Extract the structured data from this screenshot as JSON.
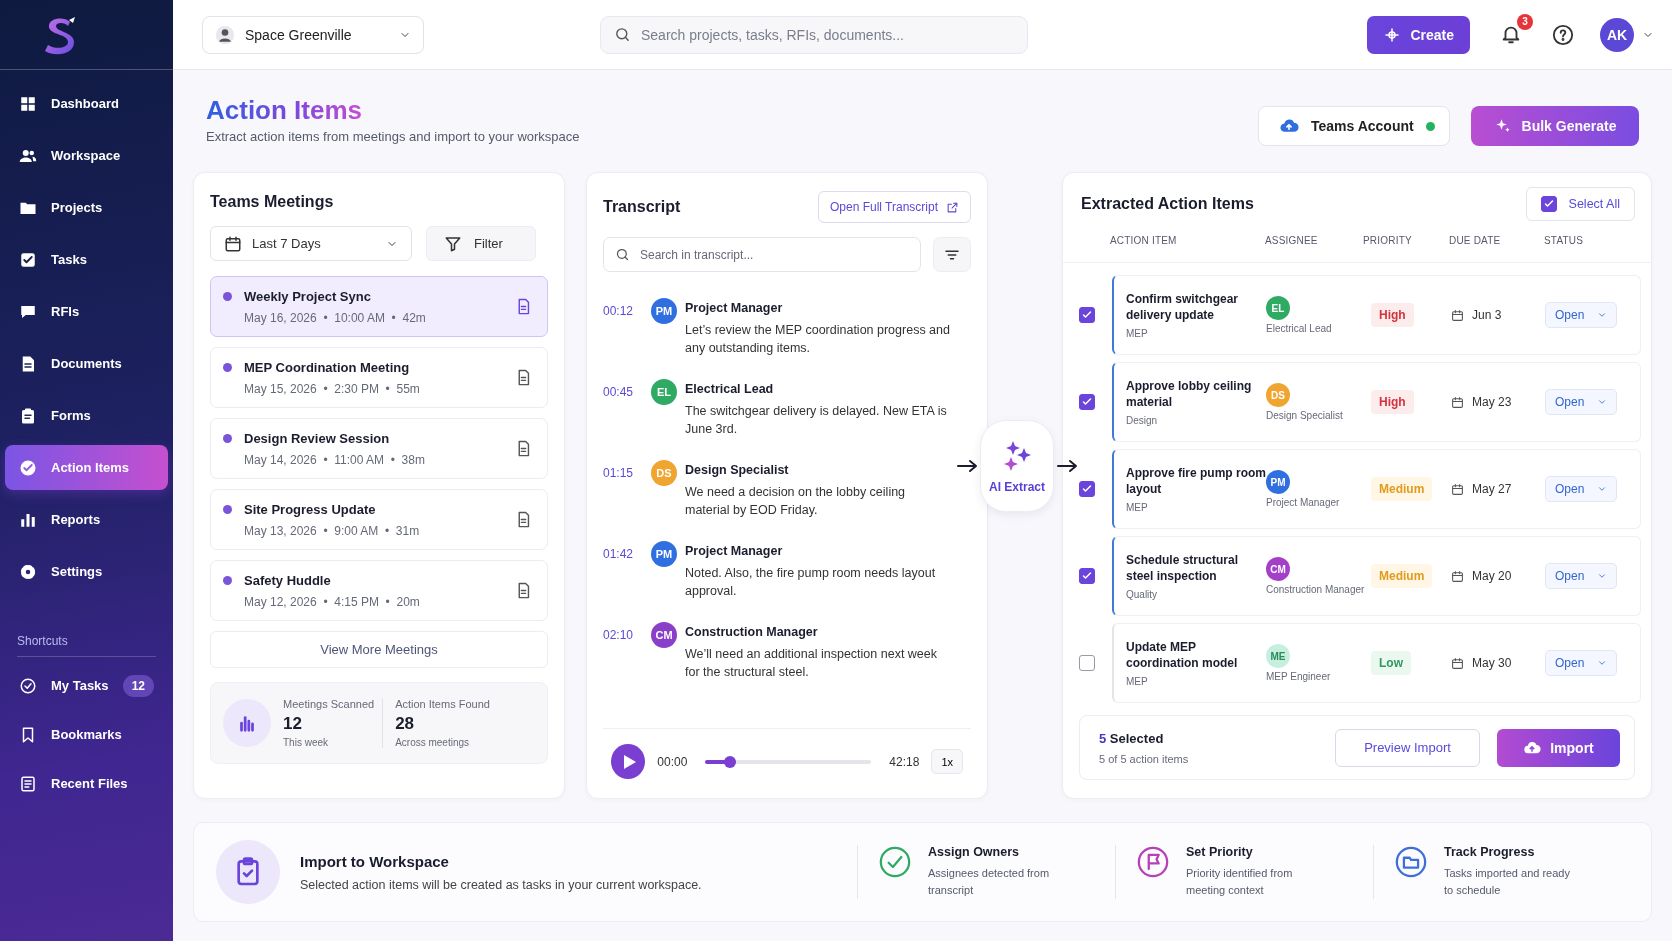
{
  "sidebar": {
    "items": [
      {
        "label": "Dashboard",
        "selected": false
      },
      {
        "label": "Workspace",
        "selected": false
      },
      {
        "label": "Projects",
        "selected": false
      },
      {
        "label": "Tasks",
        "selected": false
      },
      {
        "label": "RFIs",
        "selected": false
      },
      {
        "label": "Documents",
        "selected": false
      },
      {
        "label": "Forms",
        "selected": false
      },
      {
        "label": "Action Items",
        "selected": true
      },
      {
        "label": "Reports",
        "selected": false
      },
      {
        "label": "Settings",
        "selected": false
      }
    ],
    "shortcuts_title": "Shortcuts",
    "shortcuts": [
      {
        "label": "My Tasks",
        "badge": "12"
      },
      {
        "label": "Bookmarks"
      },
      {
        "label": "Recent Files"
      }
    ]
  },
  "topbar": {
    "workspace": "Space Greenville",
    "search": {
      "placeholder": "Search projects, tasks, RFIs, documents..."
    },
    "create": "Create",
    "notifications": "3",
    "avatar": "AK"
  },
  "header": {
    "title": "Action Items",
    "subtitle": "Extract action items from meetings and import to your workspace",
    "teams_account": {
      "label": "Teams Account",
      "connected": true
    },
    "bulk_generate": "Bulk Generate"
  },
  "meetings": {
    "title": "Teams Meetings",
    "range": "Last 7 Days",
    "filter": "Filter",
    "items": [
      {
        "title": "Weekly Project Sync",
        "meta": "May 16, 2026  •  10:00 AM  •  42m",
        "selected": true
      },
      {
        "title": "MEP Coordination Meeting",
        "meta": "May 15, 2026  •  2:30 PM  •  55m",
        "selected": false
      },
      {
        "title": "Design Review Session",
        "meta": "May 14, 2026  •  11:00 AM  •  38m",
        "selected": false
      },
      {
        "title": "Site Progress Update",
        "meta": "May 13, 2026  •  9:00 AM  •  31m",
        "selected": false
      },
      {
        "title": "Safety Huddle",
        "meta": "May 12, 2026  •  4:15 PM  •  20m",
        "selected": false
      }
    ],
    "view_more": "View More Meetings",
    "stats": [
      {
        "label": "Meetings Scanned",
        "value": "12",
        "note": "This week"
      },
      {
        "label": "Action Items Found",
        "value": "28",
        "note": "Across meetings"
      }
    ]
  },
  "transcript": {
    "title": "Transcript",
    "open_full": "Open Full Transcript",
    "search": {
      "placeholder": "Search in transcript..."
    },
    "entries": [
      {
        "time": "00:12",
        "initials": "PM",
        "speaker": "Project Manager",
        "text": "Let’s review the MEP coordination progress and any outstanding items.",
        "color": "#2f6fe0"
      },
      {
        "time": "00:45",
        "initials": "EL",
        "speaker": "Electrical Lead",
        "text": "The switchgear delivery is delayed. New ETA is June 3rd.",
        "color": "#2faa63"
      },
      {
        "time": "01:15",
        "initials": "DS",
        "speaker": "Design Specialist",
        "text": "We need a decision on the lobby ceiling material by EOD Friday.",
        "color": "#f0a530"
      },
      {
        "time": "01:42",
        "initials": "PM",
        "speaker": "Project Manager",
        "text": "Noted. Also, the fire pump room needs layout approval.",
        "color": "#2f6fe0"
      },
      {
        "time": "02:10",
        "initials": "CM",
        "speaker": "Construction Manager",
        "text": "We’ll need an additional inspection next week for the structural steel.",
        "color": "#8a3fc9"
      }
    ],
    "player": {
      "current": "00:00",
      "total": "42:18",
      "level": 0.15,
      "speed": "1x"
    }
  },
  "ai_extract": "AI Extract",
  "extracted": {
    "title": "Extracted Action Items",
    "select_all": {
      "label": "Select All",
      "checked": true
    },
    "columns": [
      "ACTION ITEM",
      "ASSIGNEE",
      "PRIORITY",
      "DUE DATE",
      "STATUS"
    ],
    "rows": [
      {
        "checked": true,
        "title": "Confirm switchgear delivery update",
        "category": "MEP",
        "initials": "EL",
        "assignee": "Electrical Lead",
        "color": "#2faa63",
        "priority": "High",
        "kind": "high",
        "due": "Jun 3",
        "status": "Open"
      },
      {
        "checked": true,
        "title": "Approve lobby ceiling material",
        "category": "Design",
        "initials": "DS",
        "assignee": "Design Specialist",
        "color": "#f0a530",
        "priority": "High",
        "kind": "high",
        "due": "May 23",
        "status": "Open"
      },
      {
        "checked": true,
        "title": "Approve fire pump room layout",
        "category": "MEP",
        "initials": "PM",
        "assignee": "Project Manager",
        "color": "#2f6fe0",
        "priority": "Medium",
        "kind": "medium",
        "due": "May 27",
        "status": "Open"
      },
      {
        "checked": true,
        "title": "Schedule structural steel inspection",
        "category": "Quality",
        "initials": "CM",
        "assignee": "Construction Manager",
        "color": "#a43fc9",
        "priority": "Medium",
        "kind": "medium",
        "due": "May 20",
        "status": "Open"
      },
      {
        "checked": false,
        "title": "Update MEP coordination model",
        "category": "MEP",
        "initials": "ME",
        "assignee": "MEP Engineer",
        "color": "#c6efdf",
        "priority": "Low",
        "kind": "low",
        "due": "May 30",
        "status": "Open"
      }
    ],
    "footer": {
      "count": "5",
      "count_label": "Selected",
      "note": "5 of 5 action items",
      "preview": "Preview Import",
      "import": "Import"
    }
  },
  "import_info": {
    "title": "Import to Workspace",
    "text": "Selected action items will be created as tasks in your current workspace.",
    "features": [
      {
        "kind": "check",
        "title": "Assign Owners",
        "text": "Assignees detected from transcript"
      },
      {
        "kind": "flag",
        "title": "Set Priority",
        "text": "Priority identified from meeting context"
      },
      {
        "kind": "folder",
        "title": "Track Progress",
        "text": "Tasks imported and ready to schedule"
      }
    ]
  }
}
